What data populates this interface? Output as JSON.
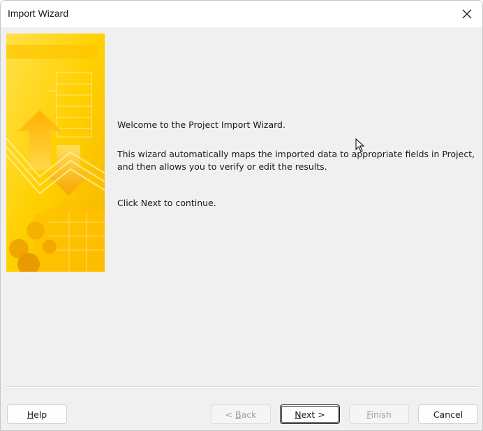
{
  "window": {
    "title": "Import Wizard"
  },
  "icons": {
    "close": "close-icon",
    "banner": "wizard-banner-illustration",
    "cursor": "mouse-cursor-icon"
  },
  "colors": {
    "banner_yellow": "#ffd200",
    "banner_orange": "#f5a800",
    "dialog_bg": "#f0f0f0"
  },
  "content": {
    "welcome": "Welcome to the Project Import Wizard.",
    "description": "This wizard automatically maps the imported data to appropriate fields in Project, and then allows you to verify or edit the results.",
    "instruction": "Click Next to continue."
  },
  "buttons": {
    "help": {
      "label": "Help",
      "mnemonic": "H",
      "enabled": true
    },
    "back": {
      "label": "< Back",
      "mnemonic": "B",
      "enabled": false
    },
    "next": {
      "label": "Next >",
      "mnemonic": "N",
      "enabled": true,
      "default": true
    },
    "finish": {
      "label": "Finish",
      "mnemonic": "F",
      "enabled": false
    },
    "cancel": {
      "label": "Cancel",
      "enabled": true
    }
  }
}
